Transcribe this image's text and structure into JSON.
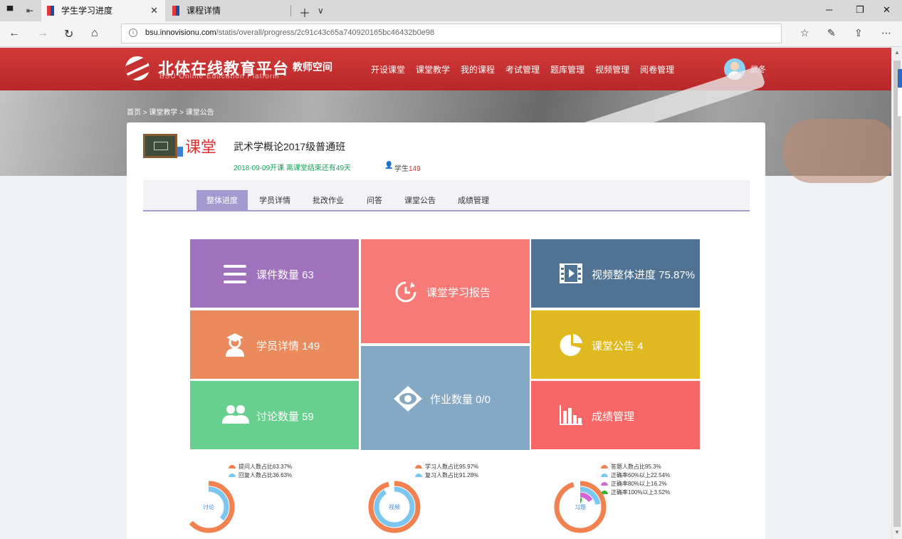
{
  "browser": {
    "tabs": [
      {
        "title": "学生学习进度",
        "active": true
      },
      {
        "title": "课程详情",
        "active": false
      }
    ],
    "url_host": "bsu.innovisionu.com",
    "url_path": "/statis/overall/progress/2c91c43c65a740920165bc46432b0e98"
  },
  "header": {
    "logo_cn": "北体在线教育平台",
    "logo_en": "BSU Online Education Platform",
    "space": "教师空间",
    "nav": [
      "开设课堂",
      "课堂教学",
      "我的课程",
      "考试管理",
      "题库管理",
      "视频管理",
      "阅卷管理"
    ],
    "user": "武冬"
  },
  "breadcrumb": "首页 > 课堂教学 > 课堂公告",
  "course": {
    "ketang": "课堂",
    "title": "武术学概论2017级普通班",
    "date": "2018-09-09开课 离课堂结束还有49天",
    "student_label": "学生",
    "student_count": "149"
  },
  "tabs": [
    "整体进度",
    "学员详情",
    "批改作业",
    "问答",
    "课堂公告",
    "成绩管理"
  ],
  "tiles": {
    "courseware": "课件数量 63",
    "report": "课堂学习报告",
    "video": "视频整体进度 75.87%",
    "students": "学员详情 149",
    "notice": "课堂公告 4",
    "homework": "作业数量 0/0",
    "discussion": "讨论数量 59",
    "grades": "成绩管理"
  },
  "colors": {
    "header": "#c83232",
    "courseware": "#a071bd",
    "report": "#f77a77",
    "video": "#507393",
    "students": "#ea8a5d",
    "notice": "#e0b921",
    "homework": "#85a8c4",
    "discussion": "#68d08f",
    "grades": "#f86767",
    "tab_active": "#a59ad0"
  },
  "charts": [
    {
      "label": "讨论",
      "legend": [
        {
          "text": "提问人数占比63.37%",
          "color": "#f28150"
        },
        {
          "text": "回复人数占比36.63%",
          "color": "#7cc7f0"
        }
      ],
      "rings": [
        {
          "color": "#f28150",
          "pct": 63.37
        },
        {
          "color": "#7cc7f0",
          "pct": 36.63
        }
      ]
    },
    {
      "label": "视频",
      "legend": [
        {
          "text": "学习人数占比95.97%",
          "color": "#f28150"
        },
        {
          "text": "复习人数占比91.28%",
          "color": "#7cc7f0"
        }
      ],
      "rings": [
        {
          "color": "#f28150",
          "pct": 95.97
        },
        {
          "color": "#7cc7f0",
          "pct": 91.28
        }
      ]
    },
    {
      "label": "习题",
      "legend": [
        {
          "text": "答题人数占比95.3%",
          "color": "#f28150"
        },
        {
          "text": "正确率60%以上22.54%",
          "color": "#7cc7f0"
        },
        {
          "text": "正确率80%以上16.2%",
          "color": "#d167d6"
        },
        {
          "text": "正确率100%以上3.52%",
          "color": "#2cb52c"
        }
      ],
      "rings": [
        {
          "color": "#f28150",
          "pct": 95.3
        },
        {
          "color": "#7cc7f0",
          "pct": 22.54
        },
        {
          "color": "#d167d6",
          "pct": 16.2
        },
        {
          "color": "#2cb52c",
          "pct": 3.52
        }
      ]
    }
  ]
}
